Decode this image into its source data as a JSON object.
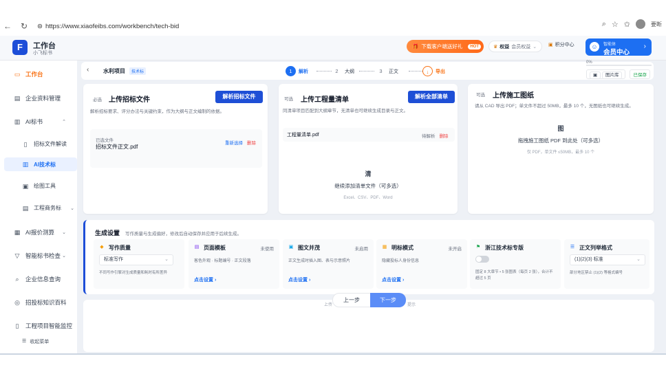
{
  "browser": {
    "url": "https://www.xiaofeibs.com/workbench/tech-bid",
    "user": "要断"
  },
  "header": {
    "title": "工作台",
    "subtitle": "小飞标书",
    "download_label": "下载客户端送好礼",
    "hot_label": "HOT",
    "rights_label": "权益",
    "rights_sub": "会员权益",
    "points_label": "积分中心",
    "member_small": "智能体",
    "member_label": "会员中心"
  },
  "sidebar": {
    "items": [
      {
        "label": "工作台",
        "icon": "monitor-icon"
      },
      {
        "label": "企业资料管理",
        "icon": "folder-icon"
      },
      {
        "label": "AI标书",
        "icon": "book-icon"
      },
      {
        "label": "招标文件解读",
        "icon": "document-icon"
      },
      {
        "label": "AI技术标",
        "icon": "book-icon"
      },
      {
        "label": "绘图工具",
        "icon": "image-icon"
      },
      {
        "label": "工程商务标",
        "icon": "folder-icon"
      },
      {
        "label": "AI报价测算",
        "icon": "calculator-icon"
      },
      {
        "label": "智能标书检查",
        "icon": "filter-icon"
      },
      {
        "label": "企业信息查询",
        "icon": "search-icon"
      },
      {
        "label": "招投标知识百科",
        "icon": "globe-icon"
      },
      {
        "label": "工程项目智能监控",
        "icon": "document-icon"
      }
    ],
    "collapse_label": "收起菜单"
  },
  "project": {
    "name": "水利项目",
    "tag": "技术标"
  },
  "steps": [
    {
      "num": "1",
      "label": "解析"
    },
    {
      "num": "2",
      "label": "大纲"
    },
    {
      "num": "3",
      "label": "正文"
    },
    {
      "num": "↓",
      "label": "导出"
    }
  ],
  "progress": {
    "label": "0%",
    "value": 0
  },
  "mini_buttons": {
    "library": "图片库",
    "saved": "已保存"
  },
  "cards": {
    "bid": {
      "tag": "必选",
      "title": "上传招标文件",
      "desc": "解析招标要求、评分办法与关键约束，作为大纲与正文编制的依据。",
      "button": "解析招标文件",
      "file_label": "已选文件",
      "file_name": "招标文件正文.pdf",
      "reselect": "重新选择",
      "delete": "删除"
    },
    "boq": {
      "tag": "可选",
      "title": "上传工程量清单",
      "desc": "同清单项目匹配到大纲章节，无清单也可继续生成目录与正文。",
      "button": "解析全部清单",
      "file_name": "工程量清单.pdf",
      "status": "待解析",
      "delete": "删除",
      "drop_icon": "清",
      "drop_text": "继续添加清单文件（可多选）",
      "drop_formats": "Excel、CSV、PDF、Word"
    },
    "drawing": {
      "tag": "可选",
      "title": "上传施工图纸",
      "desc": "请从 CAD 导出 PDF；单文件不超过 50MB，最多 10 个，无图纸也可继续生成。",
      "drop_icon": "图",
      "drop_text": "拖拽施工图纸 PDF 到此处（可多选）",
      "drop_formats": "仅 PDF，单文件 ≤50MB，最多 10 个"
    }
  },
  "generation": {
    "title": "生成设置",
    "subtitle": "写作质量与生成偏好，修改后自动保存并应用于后续生成。",
    "options": [
      {
        "title": "写作质量",
        "icon": "quality-icon",
        "select": "标准写作",
        "note": "不同写作引擎对生成质量和耗时有所差异"
      },
      {
        "title": "页面模板",
        "icon": "template-icon",
        "state": "未使用",
        "desc": "客色外观 · 标题编号 · 正文段落",
        "link": "点击设置 ›"
      },
      {
        "title": "图文并茂",
        "icon": "image-icon",
        "state": "未启用",
        "desc": "正文生成时插入图、表与示意照片",
        "link": "点击设置 ›"
      },
      {
        "title": "明标模式",
        "icon": "lock-icon",
        "state": "未开启",
        "desc": "隐藏投标人身份信息",
        "link": "点击设置 ›"
      },
      {
        "title": "浙江技术标专版",
        "icon": "flag-icon",
        "desc": "固定 8 大章节 • 5 张图表（每页 2 张），合计不超过 5 页"
      },
      {
        "title": "正文列举格式",
        "icon": "list-icon",
        "select": "(1)(2)(3) 标准",
        "note": "部分地区禁止 (1)(2) 等格式编号"
      }
    ]
  },
  "nav": {
    "prev": "上一步",
    "next": "下一步",
    "hint_left": "上传",
    "hint_right": "提示"
  }
}
